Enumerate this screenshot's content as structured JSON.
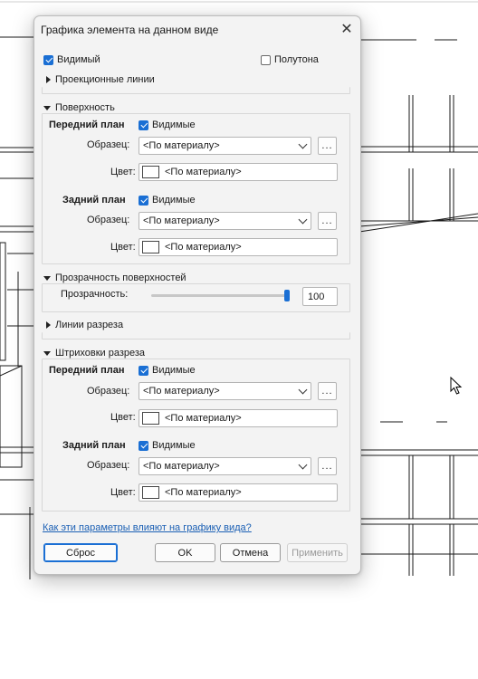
{
  "dialog": {
    "title": "Графика элемента на данном виде",
    "visible_label": "Видимый",
    "halftone_label": "Полутона",
    "projection_lines_label": "Проекционные линии",
    "surfaces": {
      "header": "Поверхность",
      "foreground": {
        "title": "Передний план",
        "visible_label": "Видимые",
        "pattern_label": "Образец:",
        "pattern_value": "<По материалу>",
        "color_label": "Цвет:",
        "color_value": "<По материалу>"
      },
      "background": {
        "title": "Задний план",
        "visible_label": "Видимые",
        "pattern_label": "Образец:",
        "pattern_value": "<По материалу>",
        "color_label": "Цвет:",
        "color_value": "<По материалу>"
      }
    },
    "transparency": {
      "header": "Прозрачность поверхностей",
      "label": "Прозрачность:",
      "value": "100",
      "level_percent": 100
    },
    "cut_lines_label": "Линии разреза",
    "cut_patterns": {
      "header": "Штриховки разреза",
      "foreground": {
        "title": "Передний план",
        "visible_label": "Видимые",
        "pattern_label": "Образец:",
        "pattern_value": "<По материалу>",
        "color_label": "Цвет:",
        "color_value": "<По материалу>"
      },
      "background": {
        "title": "Задний план",
        "visible_label": "Видимые",
        "pattern_label": "Образец:",
        "pattern_value": "<По материалу>",
        "color_label": "Цвет:",
        "color_value": "<По материалу>"
      }
    },
    "help_link": "Как эти параметры влияют на графику вида?",
    "buttons": {
      "reset": "Сброс",
      "ok": "OK",
      "cancel": "Отмена",
      "apply": "Применить"
    },
    "dots_label": "...",
    "colors": {
      "accent": "#1a6fd4",
      "link": "#1a5fb4"
    }
  }
}
